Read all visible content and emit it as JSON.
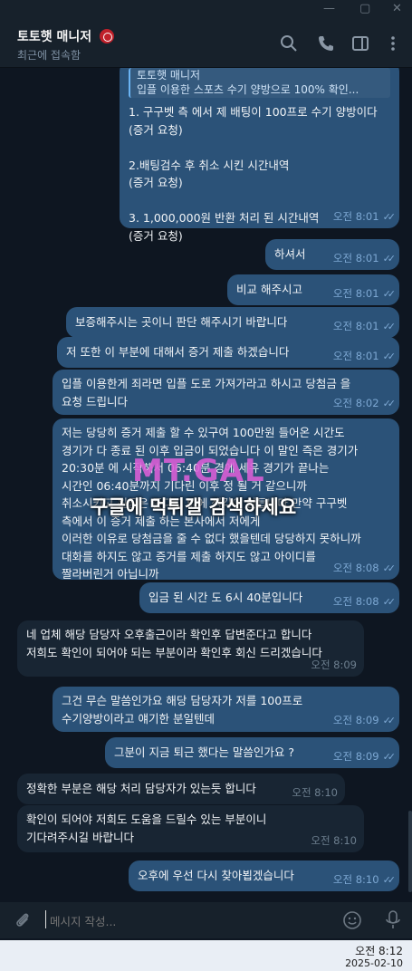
{
  "header": {
    "contact_name": "토토햇 매니저",
    "status": "최근에 접속함"
  },
  "messages": [
    {
      "side": "out",
      "quote_title": "토토햇 매니저",
      "quote_body": "입플 이용한 스포츠 수기 양방으로 100% 확인...",
      "text": "1. 구구벳 측 에서 제 배팅이 100프로 수기 양방이다\n(증거 요청)\n\n2.배팅검수 후 취소 시킨 시간내역\n(증거 요청)\n\n3. 1,000,000원 반환 처리 된 시간내역\n(증거 요청)",
      "time": "오전 8:01"
    },
    {
      "side": "out",
      "text": "하셔서",
      "time": "오전 8:01"
    },
    {
      "side": "out",
      "text": "비교 해주시고",
      "time": "오전 8:01"
    },
    {
      "side": "out",
      "text": "보증해주시는 곳이니 판단 해주시기 바랍니다",
      "time": "오전 8:01"
    },
    {
      "side": "out",
      "text": "저 또한 이 부분에 대해서 증거 제출 하겠습니다",
      "time": "오전 8:01"
    },
    {
      "side": "out",
      "text": "입플 이용한게 죄라면 입플 도로 가져가라고 하시고 당첨금 을\n요청 드립니다",
      "time": "오전 8:02"
    },
    {
      "side": "out",
      "text": "저는 당당히 증거 제출 할 수 있구여 100만원 들어온 시간도\n경기가 다 종료 된 이후 입금이 되었습니다 이 말인 즉은 경기가\n20:30분 에 시작해서 06:40분 경에 세유 경기가 끝나는\n시간인 06:40분까지 기다린 이후 정 될 거 같으니까\n취소시키고 원금은 준다고 밖에 생각이 안듭니다 만약 구구벳\n측에서 이 증거 제출 하는 본사에서 저에게\n이러한 이유로 당첨금을 줄 수 없다 했을텐데 당당하지 못하니까\n대화를 하지도 않고 증거를 제출 하지도 않고 아이디를\n짤라버린거 아닙니까",
      "time": "오전 8:08"
    },
    {
      "side": "out",
      "text": "입금 된 시간 도 6시 40분입니다",
      "time": "오전 8:08"
    },
    {
      "side": "in",
      "text": "네 업체 해당 담당자 오후출근이라 확인후 답변준다고 합니다\n저희도 확인이 되어야 되는 부분이라 확인후 회신 드리겠습니다",
      "time": "오전 8:09"
    },
    {
      "side": "out",
      "text": "그건 무슨 말씀인가요 해당 담당자가 저를 100프로\n수기양방이라고 얘기한 분일텐데",
      "time": "오전 8:09"
    },
    {
      "side": "out",
      "text": "그분이 지금 퇴근 했다는 말씀인가요 ?",
      "time": "오전 8:09"
    },
    {
      "side": "in",
      "text": "정확한 부분은 해당 처리 담당자가 있는듯 합니다",
      "time": "오전 8:10"
    },
    {
      "side": "in",
      "text": "확인이 되어야 저희도 도움을 드릴수 있는 부분이니\n기다려주시길 바랍니다",
      "time": "오전 8:10"
    },
    {
      "side": "out",
      "text": "오후에 우선 다시 찾아뵙겠습니다",
      "time": "오전 8:10"
    }
  ],
  "watermark": {
    "logo": "MT.GAL",
    "text": "구글에 먹튀갤 검색하세요"
  },
  "composer": {
    "placeholder": "메시지 작성..."
  },
  "taskbar": {
    "time": "오전 8:12",
    "date": "2025-02-10"
  },
  "colors": {
    "background": "#0e1621",
    "outgoing_bubble": "#2b5278",
    "incoming_bubble": "#182533",
    "accent": "#6ab3f3"
  }
}
